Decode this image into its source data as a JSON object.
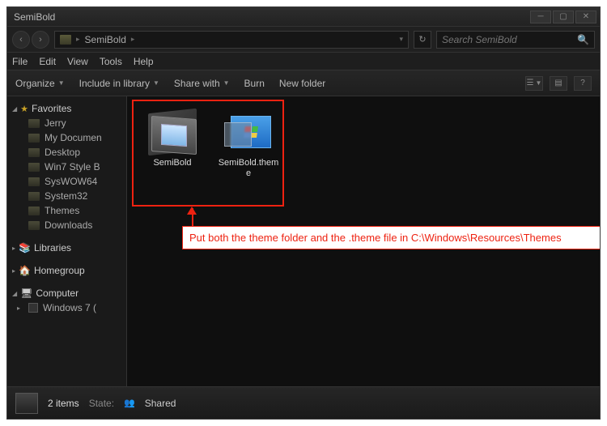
{
  "titlebar": {
    "title": "SemiBold"
  },
  "address": {
    "folder": "SemiBold",
    "separator": "›"
  },
  "search": {
    "placeholder": "Search SemiBold"
  },
  "menubar": {
    "file": "File",
    "edit": "Edit",
    "view": "View",
    "tools": "Tools",
    "help": "Help"
  },
  "toolbar": {
    "organize": "Organize",
    "include": "Include in library",
    "share": "Share with",
    "burn": "Burn",
    "newfolder": "New folder"
  },
  "sidebar": {
    "favorites": {
      "label": "Favorites",
      "items": [
        "Jerry",
        "My Documen",
        "Desktop",
        "Win7 Style B",
        "SysWOW64",
        "System32",
        "Themes",
        "Downloads"
      ]
    },
    "libraries": {
      "label": "Libraries"
    },
    "homegroup": {
      "label": "Homegroup"
    },
    "computer": {
      "label": "Computer",
      "items": [
        "Windows 7 ("
      ]
    }
  },
  "files": {
    "item0": {
      "label": "SemiBold"
    },
    "item1": {
      "label": "SemiBold.theme"
    }
  },
  "callout": {
    "text": "Put both the  theme folder and the .theme file in C:\\Windows\\Resources\\Themes"
  },
  "status": {
    "count": "2 items",
    "state_label": "State:",
    "state_value": "Shared"
  }
}
